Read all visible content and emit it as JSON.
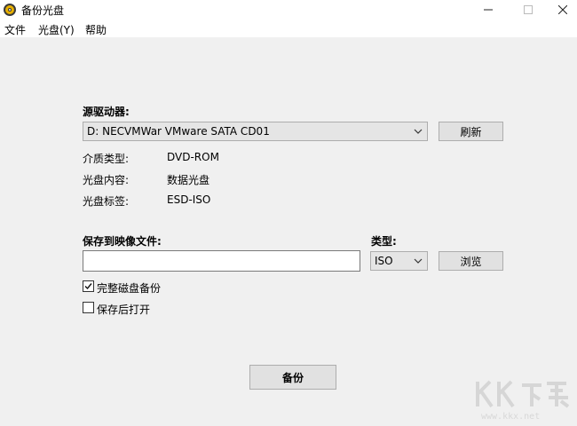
{
  "window": {
    "title": "备份光盘",
    "icon": "disc-icon",
    "controls": [
      "minimize-icon",
      "maximize-icon",
      "close-icon"
    ]
  },
  "menu": {
    "items": [
      "文件",
      "光盘(Y)",
      "帮助"
    ]
  },
  "source": {
    "label": "源驱动器:",
    "selected_drive": "D: NECVMWar VMware SATA CD01",
    "refresh_label": "刷新"
  },
  "info": {
    "media_type_label": "介质类型:",
    "media_type_value": "DVD-ROM",
    "content_label": "光盘内容:",
    "content_value": "数据光盘",
    "disc_label_label": "光盘标签:",
    "disc_label_value": "ESD-ISO"
  },
  "save": {
    "label": "保存到映像文件:",
    "path_value": "",
    "type_label": "类型:",
    "type_value": "ISO",
    "browse_label": "浏览"
  },
  "options": {
    "full_backup_label": "完整磁盘备份",
    "full_backup_checked": true,
    "open_after_label": "保存后打开",
    "open_after_checked": false
  },
  "actions": {
    "backup_label": "备份"
  },
  "watermark": {
    "url": "www.kkx.net"
  },
  "colors": {
    "window_bg": "#f0f0f0",
    "titlebar_bg": "#ffffff",
    "button_bg": "#e1e1e1",
    "select_bg": "#e5e5e5"
  }
}
